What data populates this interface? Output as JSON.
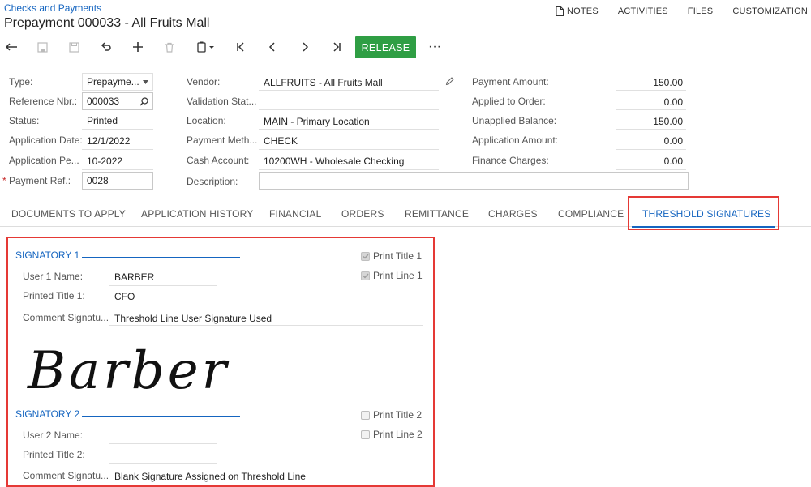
{
  "breadcrumb": "Checks and Payments",
  "title": "Prepayment 000033 - All Fruits Mall",
  "top_links": [
    "NOTES",
    "ACTIVITIES",
    "FILES",
    "CUSTOMIZATION"
  ],
  "toolbar": {
    "release_label": "RELEASE",
    "more_label": "···"
  },
  "form": {
    "type_label": "Type:",
    "type_value": "Prepayme...",
    "refnbr_label": "Reference Nbr.:",
    "refnbr_value": "000033",
    "status_label": "Status:",
    "status_value": "Printed",
    "appdate_label": "Application Date:",
    "appdate_value": "12/1/2022",
    "appperiod_label": "Application Pe...",
    "appperiod_value": "10-2022",
    "payref_label": "Payment Ref.:",
    "payref_value": "0028",
    "payref_required": "*",
    "vendor_label": "Vendor:",
    "vendor_value": "ALLFRUITS - All Fruits Mall",
    "validation_label": "Validation Stat...",
    "location_label": "Location:",
    "location_value": "MAIN - Primary Location",
    "paymethod_label": "Payment Meth...",
    "paymethod_value": "CHECK",
    "cashaccount_label": "Cash Account:",
    "cashaccount_value": "10200WH - Wholesale Checking",
    "description_label": "Description:",
    "description_value": "",
    "payment_amount_label": "Payment Amount:",
    "payment_amount_value": "150.00",
    "applied_order_label": "Applied to Order:",
    "applied_order_value": "0.00",
    "unapplied_label": "Unapplied Balance:",
    "unapplied_value": "150.00",
    "app_amount_label": "Application Amount:",
    "app_amount_value": "0.00",
    "finance_label": "Finance Charges:",
    "finance_value": "0.00"
  },
  "tabs": [
    "DOCUMENTS TO APPLY",
    "APPLICATION HISTORY",
    "FINANCIAL",
    "ORDERS",
    "REMITTANCE",
    "CHARGES",
    "COMPLIANCE",
    "THRESHOLD SIGNATURES"
  ],
  "signatory1": {
    "title": "SIGNATORY 1",
    "user_label": "User 1 Name:",
    "user_value": "BARBER",
    "printed_label": "Printed Title 1:",
    "printed_value": "CFO",
    "comment_label": "Comment Signatu...",
    "comment_value": "Threshold Line User Signature Used",
    "print_title_label": "Print Title 1",
    "print_title_checked": true,
    "print_line_label": "Print Line 1",
    "print_line_checked": true,
    "signature_text": "Barber"
  },
  "signatory2": {
    "title": "SIGNATORY 2",
    "user_label": "User 2 Name:",
    "user_value": "",
    "printed_label": "Printed Title 2:",
    "printed_value": "",
    "comment_label": "Comment Signatu...",
    "comment_value": "Blank Signature Assigned on Threshold Line",
    "print_title_label": "Print Title 2",
    "print_title_checked": false,
    "print_line_label": "Print Line 2",
    "print_line_checked": false
  },
  "colors": {
    "accent": "#1565c0",
    "release": "#2f9e44",
    "highlight": "#e53935"
  }
}
